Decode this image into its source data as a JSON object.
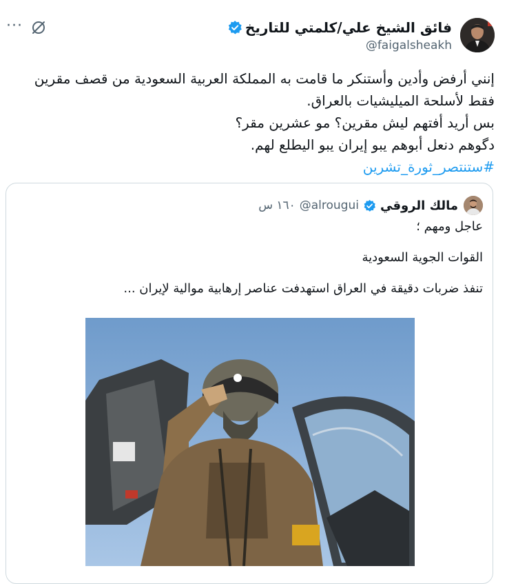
{
  "tweet": {
    "author_name": "فائق الشيخ علي/كلمتي للتاريخ",
    "author_handle": "@faigalsheakh",
    "more_label": "···",
    "text_lines": [
      "إنني أرفض وأدين وأستنكر ما قامت به المملكة العربية السعودية من قصف مقرين",
      "فقط لأسلحة الميليشيات بالعراق.",
      "بس أريد أفتهم ليش مقرين؟ مو عشرين مقر؟",
      "دگوهم دنعل أبوهم يبو إيران يبو اليطلع لهم."
    ],
    "hashtag": "#ستنتصر_ثورة_تشرين"
  },
  "quote": {
    "author_name": "مالك الروقي",
    "author_handle": "@alrougui",
    "time": "١٦٠ س",
    "paragraphs": [
      "عاجل ومهم ؛",
      "القوات الجوية السعودية",
      "تنفذ ضربات دقيقة في العراق استهدفت عناصر إرهابية موالية لإيران  ..."
    ]
  },
  "colors": {
    "accent": "#1d9bf0",
    "text": "#0f1419",
    "secondary": "#536471",
    "border": "#cfd9de"
  },
  "icons": {
    "verified": "verified-badge-icon",
    "grok": "grok-icon",
    "more": "more-options-icon"
  }
}
